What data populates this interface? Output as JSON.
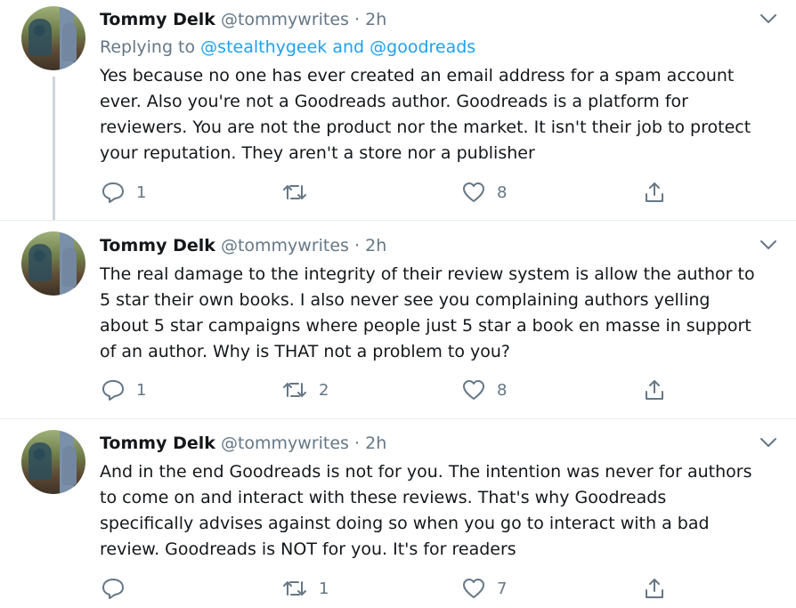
{
  "tweets": [
    {
      "name": "Tommy Delk",
      "handle": "@tommywrites",
      "separator": "·",
      "time": "2h",
      "replying_prefix": "Replying to",
      "replying_to": "@stealthygeek and @goodreads",
      "body_lines": [
        "Yes because no one has ever created an email address for a spam account",
        "ever. Also you're not a Goodreads author. Goodreads is a platform for",
        "reviewers. You are not the product nor the market. It isn't their job to protect",
        "your reputation. They aren't a store nor a publisher"
      ],
      "replies": "1",
      "retweets": "",
      "likes": "8"
    },
    {
      "name": "Tommy Delk",
      "handle": "@tommywrites",
      "separator": "·",
      "time": "2h",
      "body_lines": [
        "The real damage to the integrity of their review system is allow the author to",
        "5 star their own books. I also never see you complaining authors yelling",
        "about 5 star campaigns where people just 5 star a book en masse in support",
        "of an author. Why is THAT not a problem to you?"
      ],
      "replies": "1",
      "retweets": "2",
      "likes": "8"
    },
    {
      "name": "Tommy Delk",
      "handle": "@tommywrites",
      "separator": "·",
      "time": "2h",
      "body_lines": [
        "And in the end Goodreads is not for you. The intention was never for authors",
        "to come on and interact with these reviews. That's why Goodreads",
        "specifically advises against doing so when you go to interact with a bad",
        "review. Goodreads is NOT for you. It's for readers"
      ],
      "replies": "",
      "retweets": "1",
      "likes": "7"
    }
  ],
  "icons": {
    "reply": "reply-icon",
    "retweet": "retweet-icon",
    "like": "like-icon",
    "share": "share-icon",
    "more": "chevron-down-icon"
  },
  "colors": {
    "text": "#14171a",
    "secondary": "#657786",
    "link": "#1da1f2",
    "divider": "#e6ecf0",
    "thread_line": "#cdd6dd"
  }
}
